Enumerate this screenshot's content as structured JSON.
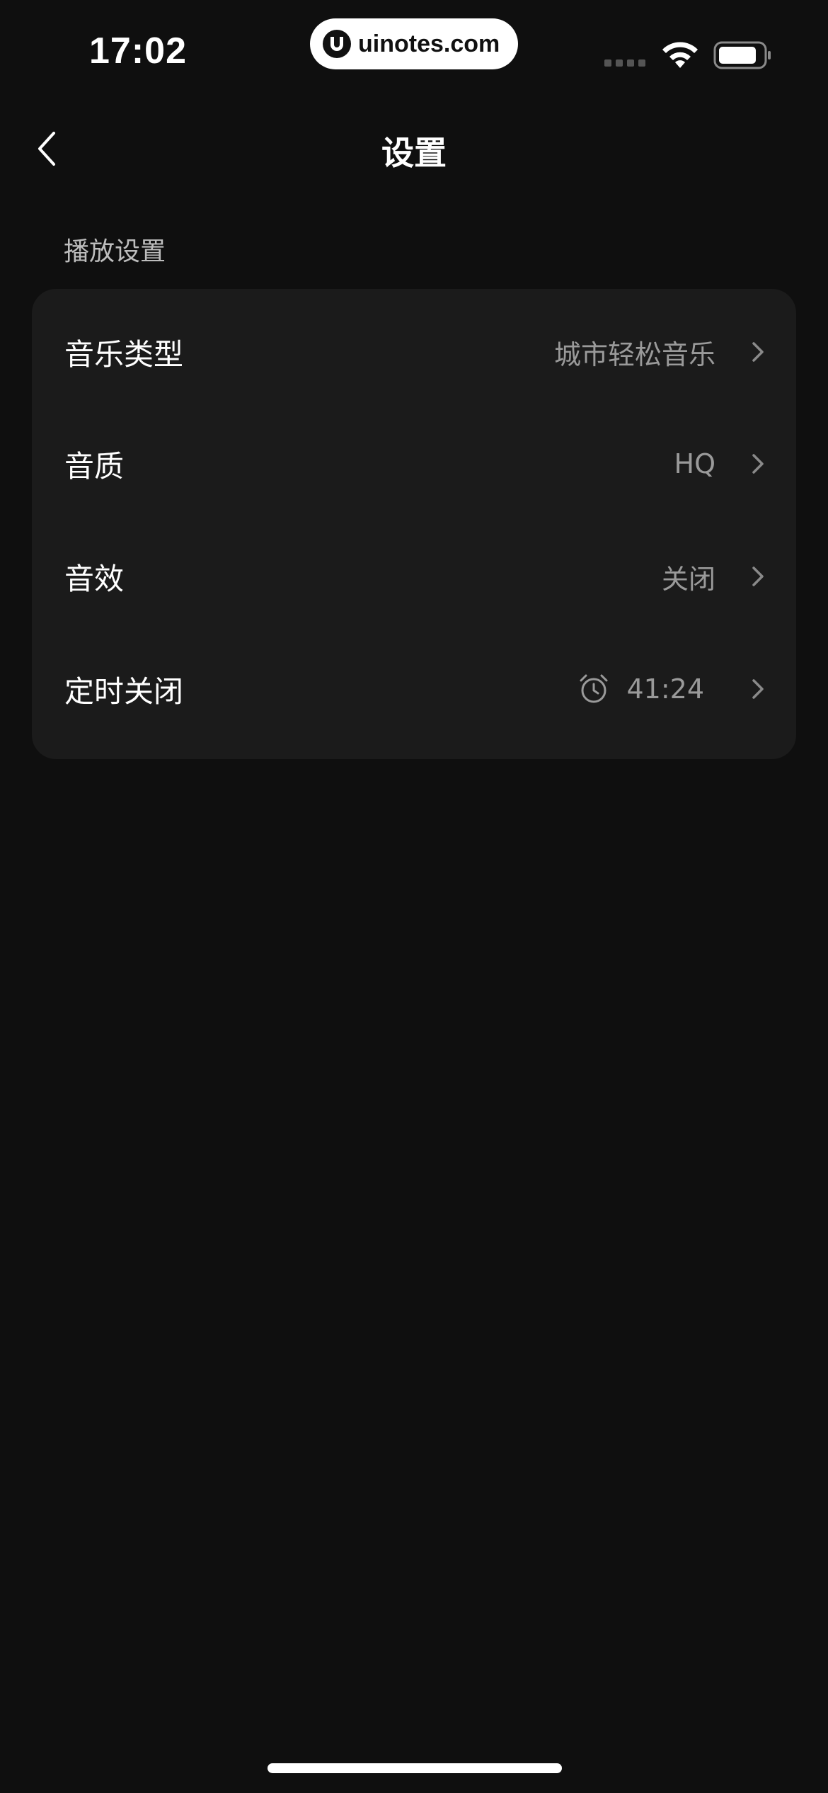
{
  "status_bar": {
    "time": "17:02",
    "watermark": "uinotes.com",
    "icons": [
      "signal-icon",
      "wifi-icon",
      "battery-icon"
    ]
  },
  "nav": {
    "title": "设置",
    "back_icon": "chevron-left-icon"
  },
  "section": {
    "header": "播放设置",
    "rows": [
      {
        "label": "音乐类型",
        "value": "城市轻松音乐"
      },
      {
        "label": "音质",
        "value": "HQ"
      },
      {
        "label": "音效",
        "value": "关闭"
      },
      {
        "label": "定时关闭",
        "value": "41:24",
        "icon": "alarm-clock-icon"
      }
    ]
  },
  "colors": {
    "background": "#0f0f0f",
    "card": "#1b1b1b",
    "text_primary": "#ffffff",
    "text_secondary": "#9a9a9a"
  }
}
